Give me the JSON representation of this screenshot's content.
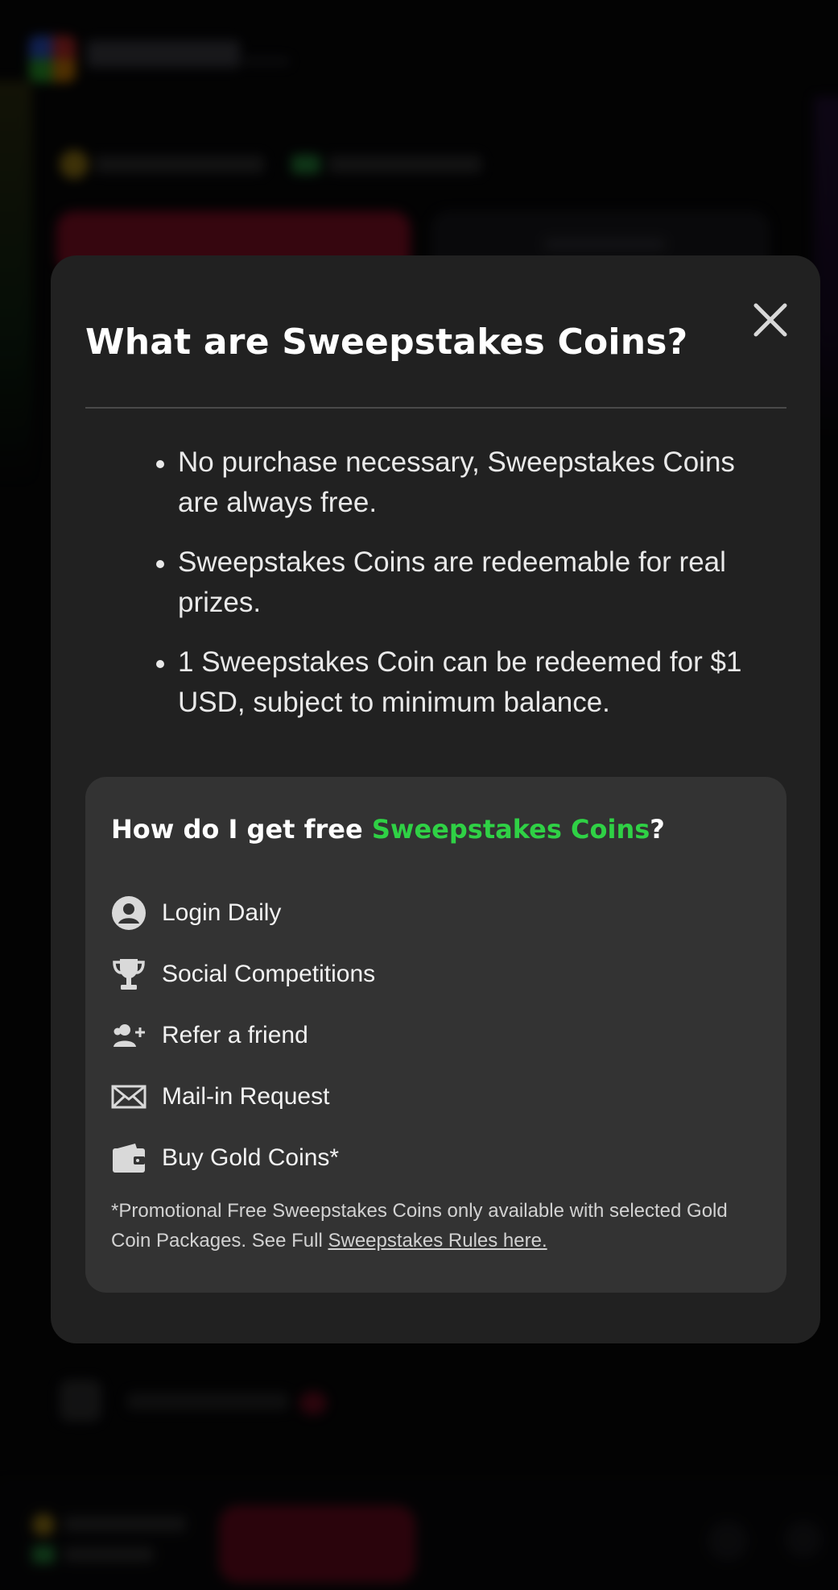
{
  "modal": {
    "title": "What are Sweepstakes Coins?",
    "bullets": [
      "No purchase necessary, Sweepstakes Coins are always free.",
      "Sweepstakes Coins are redeemable for real prizes.",
      "1 Sweepstakes Coin can be redeemed for $1 USD, subject to minimum balance."
    ],
    "close_icon": "close-icon"
  },
  "card": {
    "heading_prefix": "How do I get free ",
    "heading_accent": "Sweepstakes Coins",
    "heading_suffix": "?",
    "accent_color": "#2fd145",
    "ways": [
      {
        "label": "Login Daily",
        "icon": "user-circle-icon"
      },
      {
        "label": "Social Competitions",
        "icon": "trophy-icon"
      },
      {
        "label": "Refer a friend",
        "icon": "add-friend-icon"
      },
      {
        "label": "Mail-in Request",
        "icon": "envelope-icon"
      },
      {
        "label": "Buy Gold Coins*",
        "icon": "wallet-icon"
      }
    ],
    "footnote_text": "*Promotional Free Sweepstakes Coins only available with selected Gold Coin Packages. See Full ",
    "footnote_link": "Sweepstakes Rules here."
  },
  "colors": {
    "modal_bg": "#212121",
    "card_bg": "#333333",
    "overlay": "#060607"
  }
}
